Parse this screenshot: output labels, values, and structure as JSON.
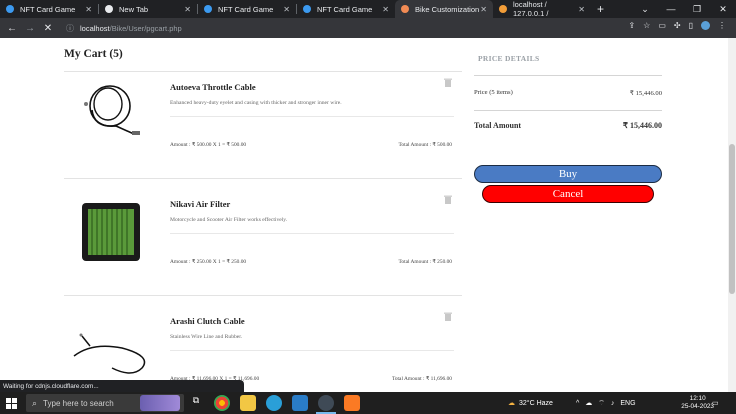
{
  "browser": {
    "tabs": [
      {
        "title": "NFT Card Game",
        "favicon_color": "#3c9af0",
        "active": false
      },
      {
        "title": "New Tab",
        "favicon_color": "#e8eaed",
        "active": false
      },
      {
        "title": "NFT Card Game",
        "favicon_color": "#3c9af0",
        "active": false
      },
      {
        "title": "NFT Card Game",
        "favicon_color": "#3c9af0",
        "active": false
      },
      {
        "title": "Bike Customization",
        "favicon_color": "#f28b54",
        "active": true
      },
      {
        "title": "localhost / 127.0.0.1 /",
        "favicon_color": "#f29d38",
        "active": false
      }
    ],
    "url_host": "localhost",
    "url_path": "/Bike/User/pgcart.php",
    "status_text": "Waiting for cdnjs.cloudflare.com..."
  },
  "cart": {
    "title": "My Cart (5)",
    "items": [
      {
        "name": "Autoeva Throttle Cable",
        "desc": "Enhanced heavy-duty eyelet and casing with thicker and stronger inner wire.",
        "amount": "Amount : ₹ 500.00 X 1 = ₹ 500.00",
        "total": "Total Amount : ₹ 500.00",
        "image": "throttle-cable"
      },
      {
        "name": "Nikavi Air Filter",
        "desc": "Motorcycle and Scooter Air Filter works effectively.",
        "amount": "Amount : ₹ 250.00 X 1 = ₹ 250.00",
        "total": "Total Amount : ₹ 250.00",
        "image": "air-filter"
      },
      {
        "name": "Arashi Clutch Cable",
        "desc": "Stainless Wire Line and Rubber.",
        "amount": "Amount : ₹ 11,696.00 X 1 = ₹ 11,696.00",
        "total": "Total Amount : ₹ 11,696.00",
        "image": "clutch-cable"
      }
    ]
  },
  "price_details": {
    "title": "PRICE DETAILS",
    "price_label": "Price (5 items)",
    "price_value": "₹ 15,446.00",
    "total_label": "Total Amount",
    "total_value": "₹ 15,446.00",
    "buy_label": "Buy",
    "cancel_label": "Cancel",
    "buy_color": "#4a7bc4",
    "cancel_color": "#ff0000"
  },
  "taskbar": {
    "search_placeholder": "Type here to search",
    "weather": "32°C  Haze",
    "language": "ENG",
    "time": "12:10",
    "date": "25-04-2023"
  }
}
